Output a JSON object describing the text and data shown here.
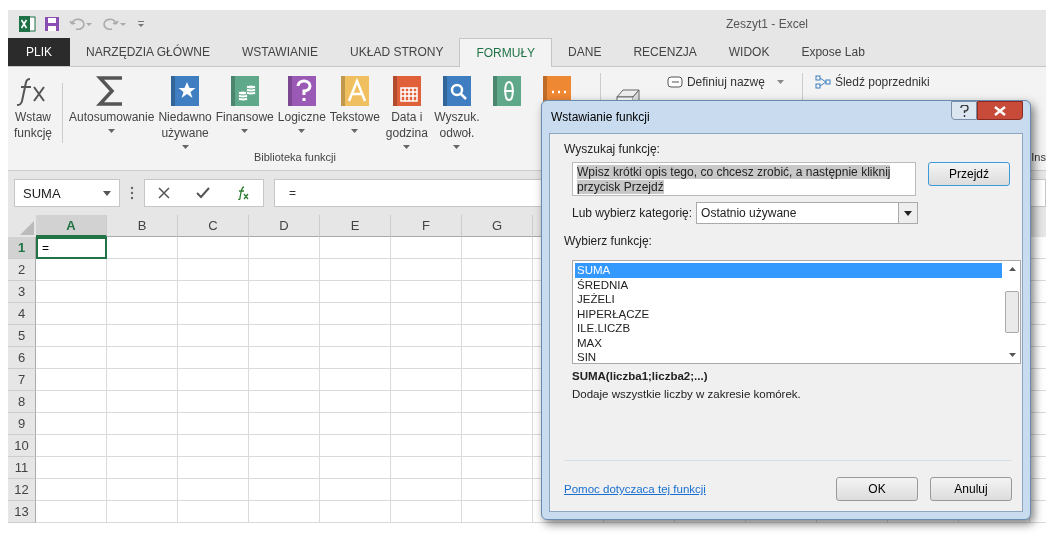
{
  "window": {
    "title": "Zeszyt1 - Excel"
  },
  "tabs": [
    {
      "label": "PLIK",
      "kind": "file",
      "selected": false
    },
    {
      "label": "NARZĘDZIA GŁÓWNE",
      "kind": "tab",
      "selected": false
    },
    {
      "label": "WSTAWIANIE",
      "kind": "tab",
      "selected": false
    },
    {
      "label": "UKŁAD STRONY",
      "kind": "tab",
      "selected": false
    },
    {
      "label": "FORMUŁY",
      "kind": "tab",
      "selected": true
    },
    {
      "label": "DANE",
      "kind": "tab",
      "selected": false
    },
    {
      "label": "RECENZJA",
      "kind": "tab",
      "selected": false
    },
    {
      "label": "WIDOK",
      "kind": "tab",
      "selected": false
    },
    {
      "label": "Expose Lab",
      "kind": "tab",
      "selected": false
    }
  ],
  "ribbon": {
    "group_label": "Biblioteka funkcji",
    "buttons": [
      {
        "kind": "fx",
        "lines": [
          "Wstaw",
          "funkcję"
        ],
        "dropdown": false
      },
      {
        "kind": "sigma",
        "lines": [
          "Autosumowanie"
        ],
        "dropdown": true
      },
      {
        "kind": "star",
        "lines": [
          "Niedawno",
          "używane"
        ],
        "dropdown": true
      },
      {
        "kind": "coins",
        "lines": [
          "Finansowe"
        ],
        "dropdown": true
      },
      {
        "kind": "question",
        "lines": [
          "Logiczne"
        ],
        "dropdown": true
      },
      {
        "kind": "letter",
        "lines": [
          "Tekstowe"
        ],
        "dropdown": true
      },
      {
        "kind": "calendar",
        "lines": [
          "Data i",
          "godzina"
        ],
        "dropdown": true
      },
      {
        "kind": "magnifier",
        "lines": [
          "Wyszuk.",
          "odwoł."
        ],
        "dropdown": true
      },
      {
        "kind": "theta",
        "dropdown": false
      },
      {
        "kind": "more",
        "dropdown": false
      }
    ],
    "name_items": [
      {
        "label": "Definiuj nazwę",
        "dropdown": true
      }
    ],
    "audit_items": [
      {
        "label": "Śledź poprzedniki"
      }
    ],
    "cut_label": "Ins"
  },
  "formula_bar": {
    "name_box": "SUMA",
    "formula": "="
  },
  "grid": {
    "columns": [
      {
        "label": "A",
        "selected": true
      },
      {
        "label": "B",
        "selected": false
      },
      {
        "label": "C",
        "selected": false
      },
      {
        "label": "D",
        "selected": false
      },
      {
        "label": "E",
        "selected": false
      },
      {
        "label": "F",
        "selected": false
      },
      {
        "label": "G",
        "selected": false
      }
    ],
    "rows": [
      {
        "label": "1",
        "selected": true,
        "cell_a": "="
      },
      {
        "label": "2",
        "selected": false
      },
      {
        "label": "3",
        "selected": false
      },
      {
        "label": "4",
        "selected": false
      },
      {
        "label": "5",
        "selected": false
      },
      {
        "label": "6",
        "selected": false
      },
      {
        "label": "7",
        "selected": false
      },
      {
        "label": "8",
        "selected": false
      },
      {
        "label": "9",
        "selected": false
      },
      {
        "label": "10",
        "selected": false
      },
      {
        "label": "11",
        "selected": false
      },
      {
        "label": "12",
        "selected": false
      },
      {
        "label": "13",
        "selected": false
      }
    ]
  },
  "dialog": {
    "title": "Wstawianie funkcji",
    "search_label": "Wyszukaj funkcję:",
    "search_value": "Wpisz krótki opis tego, co chcesz zrobić, a następnie kliknij przycisk Przejdź",
    "go_button": "Przejdź",
    "category_label": "Lub wybierz kategorię:",
    "category_value": "Ostatnio używane",
    "list_label": "Wybierz funkcję:",
    "functions": [
      {
        "name": "SUMA",
        "selected": true
      },
      {
        "name": "ŚREDNIA",
        "selected": false
      },
      {
        "name": "JEŻELI",
        "selected": false
      },
      {
        "name": "HIPERŁĄCZE",
        "selected": false
      },
      {
        "name": "ILE.LICZB",
        "selected": false
      },
      {
        "name": "MAX",
        "selected": false
      },
      {
        "name": "SIN",
        "selected": false
      }
    ],
    "signature": "SUMA(liczba1;liczba2;...)",
    "description": "Dodaje wszystkie liczby w zakresie komórek.",
    "help_link": "Pomoc dotyczaca tej funkcji",
    "ok": "OK",
    "cancel": "Anuluj"
  }
}
